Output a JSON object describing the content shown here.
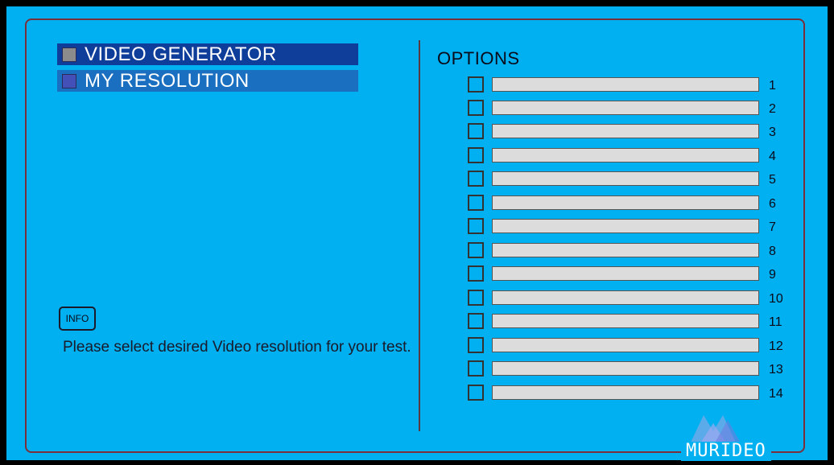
{
  "menu": {
    "items": [
      {
        "label": "VIDEO GENERATOR"
      },
      {
        "label": "MY RESOLUTION"
      }
    ]
  },
  "info": {
    "button_label": "INFO",
    "message": "Please select desired Video resolution for your test."
  },
  "options": {
    "title": "OPTIONS",
    "rows": [
      {
        "number": "1",
        "value": ""
      },
      {
        "number": "2",
        "value": ""
      },
      {
        "number": "3",
        "value": ""
      },
      {
        "number": "4",
        "value": ""
      },
      {
        "number": "5",
        "value": ""
      },
      {
        "number": "6",
        "value": ""
      },
      {
        "number": "7",
        "value": ""
      },
      {
        "number": "8",
        "value": ""
      },
      {
        "number": "9",
        "value": ""
      },
      {
        "number": "10",
        "value": ""
      },
      {
        "number": "11",
        "value": ""
      },
      {
        "number": "12",
        "value": ""
      },
      {
        "number": "13",
        "value": ""
      },
      {
        "number": "14",
        "value": ""
      }
    ]
  },
  "brand": {
    "logo_text": "MURIDEO",
    "logo_icon": "mountain-logo-icon"
  },
  "colors": {
    "background": "#00b0f0",
    "frame": "#7a2f3a",
    "menu_active": "#0e3d9a",
    "menu_inactive": "#1a6fc0",
    "option_field": "#dcdcdc"
  }
}
